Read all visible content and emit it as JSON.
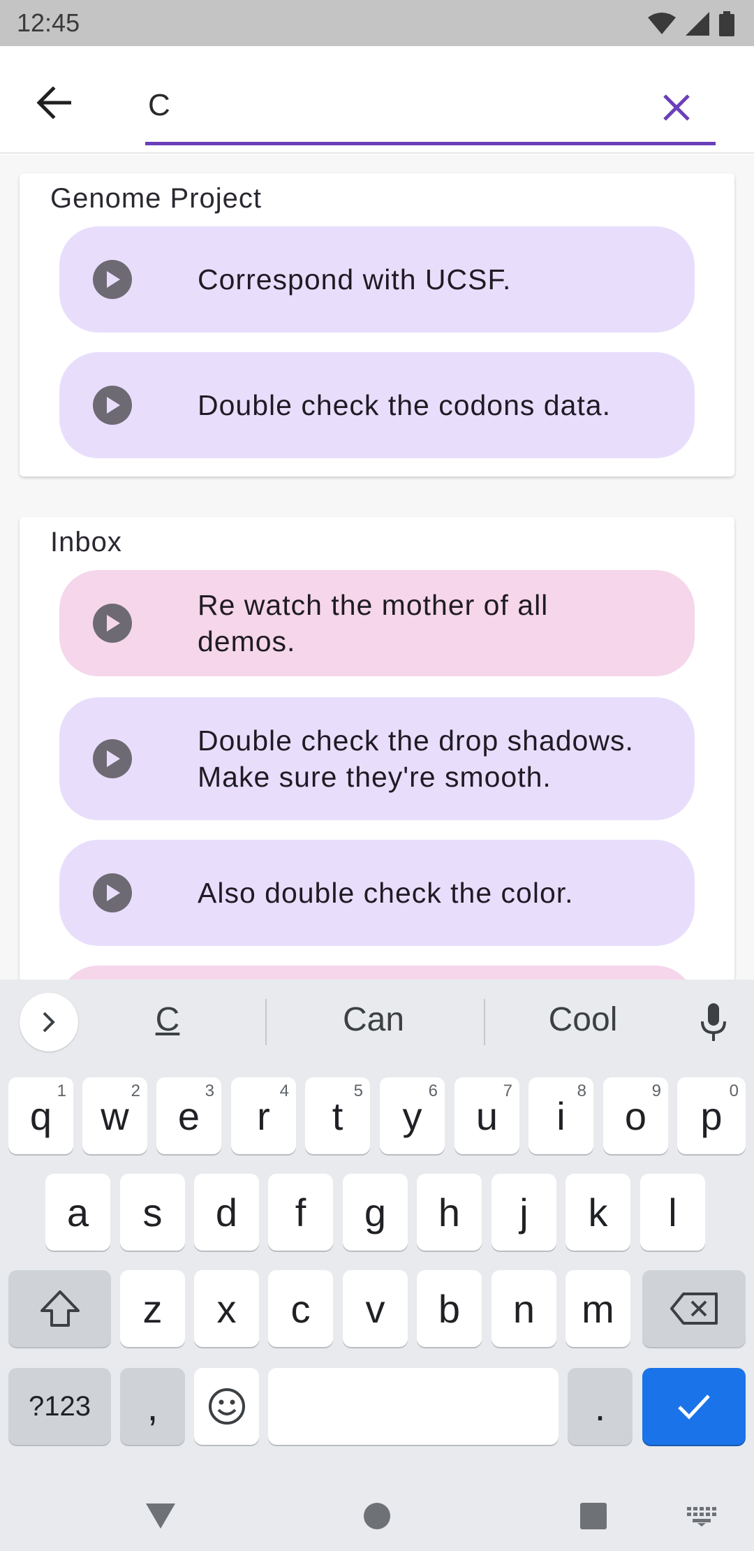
{
  "status_bar": {
    "time": "12:45"
  },
  "search": {
    "value": "C",
    "placeholder": ""
  },
  "lists": [
    {
      "title": "Genome Project",
      "tasks": [
        {
          "label": "Correspond with UCSF.",
          "color": "#e8defc"
        },
        {
          "label": "Double check the codons data.",
          "color": "#e8defc"
        }
      ]
    },
    {
      "title": "Inbox",
      "tasks": [
        {
          "label": "Re watch the mother of all demos.",
          "color": "#f5d6ea"
        },
        {
          "label": "Double check the drop shadows. Make sure they're smooth.",
          "color": "#e8defc"
        },
        {
          "label": "Also double check the color.",
          "color": "#e8defc"
        }
      ]
    }
  ],
  "keyboard": {
    "suggestions": [
      "C",
      "Can",
      "Cool"
    ],
    "row1": [
      {
        "k": "q",
        "h": "1"
      },
      {
        "k": "w",
        "h": "2"
      },
      {
        "k": "e",
        "h": "3"
      },
      {
        "k": "r",
        "h": "4"
      },
      {
        "k": "t",
        "h": "5"
      },
      {
        "k": "y",
        "h": "6"
      },
      {
        "k": "u",
        "h": "7"
      },
      {
        "k": "i",
        "h": "8"
      },
      {
        "k": "o",
        "h": "9"
      },
      {
        "k": "p",
        "h": "0"
      }
    ],
    "row2": [
      "a",
      "s",
      "d",
      "f",
      "g",
      "h",
      "j",
      "k",
      "l"
    ],
    "row3": [
      "z",
      "x",
      "c",
      "v",
      "b",
      "n",
      "m"
    ],
    "symbols_label": "?123",
    "comma": ",",
    "period": "."
  },
  "colors": {
    "accent": "#6a3fb8",
    "task_lavender": "#e8defc",
    "task_pink": "#f5d6ea",
    "enter_key": "#1a73e8"
  },
  "icons": {
    "back": "arrow-left-icon",
    "clear": "close-icon",
    "play": "play-icon",
    "mic": "mic-icon",
    "shift": "shift-icon",
    "backspace": "backspace-icon",
    "emoji": "emoji-icon",
    "enter": "check-icon"
  }
}
